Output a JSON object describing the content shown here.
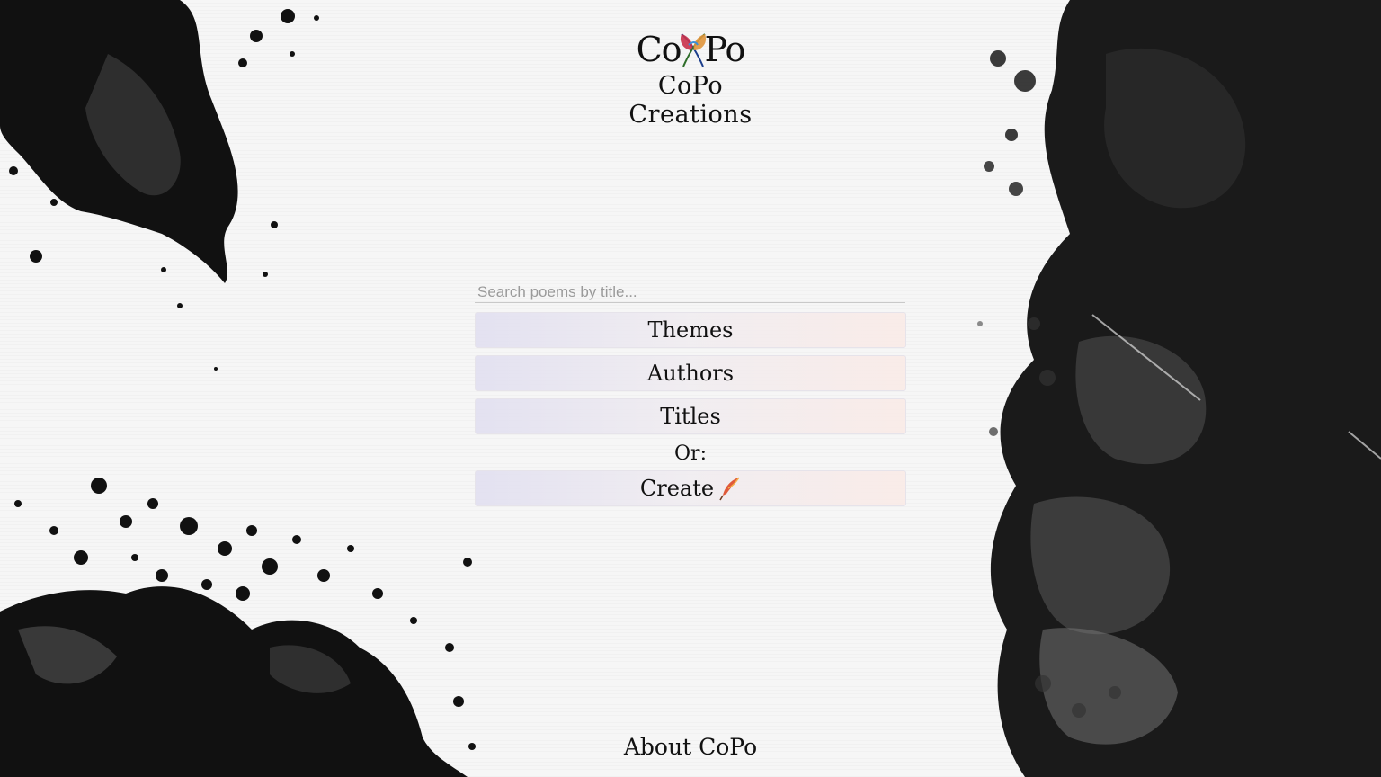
{
  "brand": {
    "logo_text_left": "Co",
    "logo_text_right": "Po",
    "title": "CoPo Creations"
  },
  "search": {
    "placeholder": "Search poems by title..."
  },
  "nav": {
    "themes_label": "Themes",
    "authors_label": "Authors",
    "titles_label": "Titles",
    "or_label": "Or:",
    "create_label": "Create"
  },
  "footer": {
    "about_label": "About CoPo"
  },
  "colors": {
    "button_gradient_left": "#e0def0",
    "button_gradient_right": "#faeae6",
    "ink": "#111111"
  },
  "icons": {
    "logo_feathers": "crossed-feathers-icon",
    "create": "quill-icon"
  }
}
